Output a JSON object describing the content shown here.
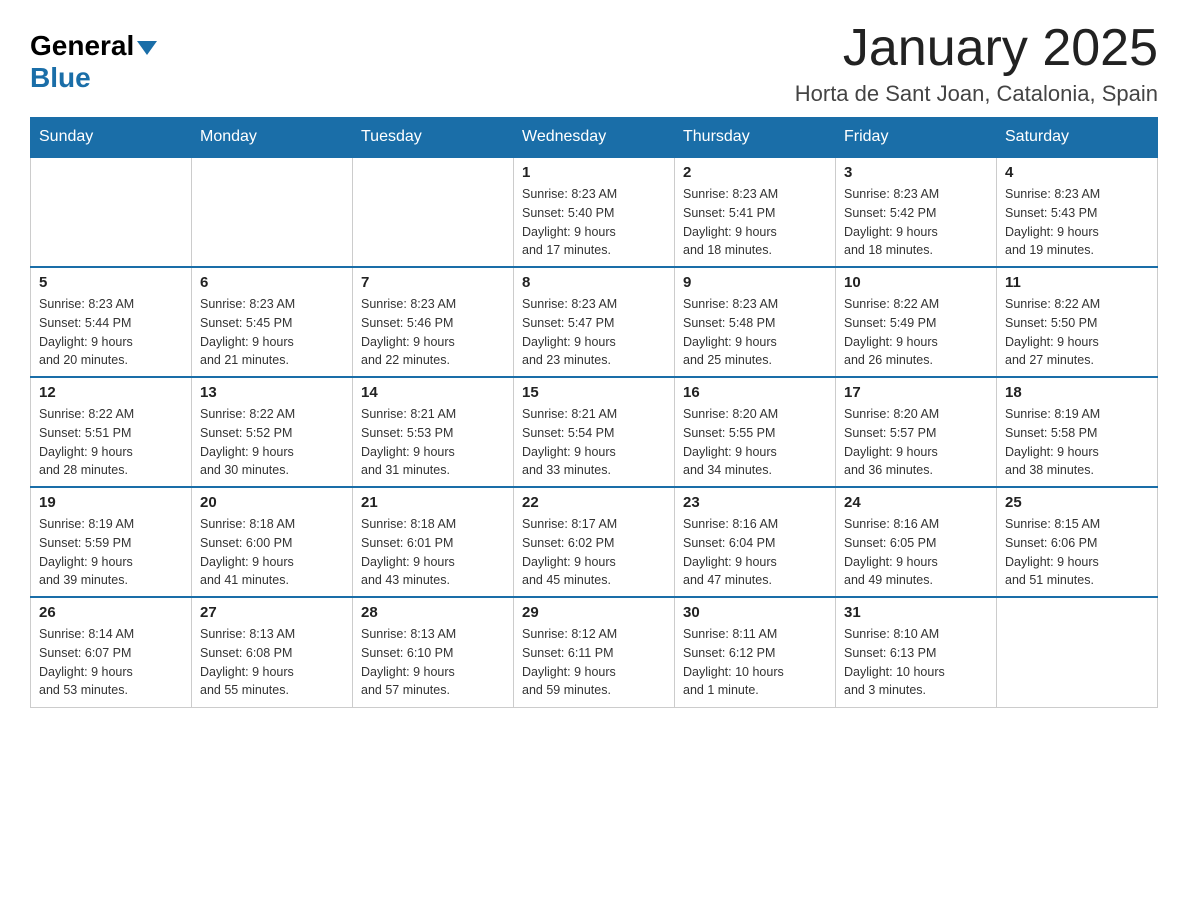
{
  "logo": {
    "general": "General",
    "blue": "Blue"
  },
  "title": "January 2025",
  "location": "Horta de Sant Joan, Catalonia, Spain",
  "weekdays": [
    "Sunday",
    "Monday",
    "Tuesday",
    "Wednesday",
    "Thursday",
    "Friday",
    "Saturday"
  ],
  "weeks": [
    [
      {
        "day": "",
        "info": ""
      },
      {
        "day": "",
        "info": ""
      },
      {
        "day": "",
        "info": ""
      },
      {
        "day": "1",
        "info": "Sunrise: 8:23 AM\nSunset: 5:40 PM\nDaylight: 9 hours\nand 17 minutes."
      },
      {
        "day": "2",
        "info": "Sunrise: 8:23 AM\nSunset: 5:41 PM\nDaylight: 9 hours\nand 18 minutes."
      },
      {
        "day": "3",
        "info": "Sunrise: 8:23 AM\nSunset: 5:42 PM\nDaylight: 9 hours\nand 18 minutes."
      },
      {
        "day": "4",
        "info": "Sunrise: 8:23 AM\nSunset: 5:43 PM\nDaylight: 9 hours\nand 19 minutes."
      }
    ],
    [
      {
        "day": "5",
        "info": "Sunrise: 8:23 AM\nSunset: 5:44 PM\nDaylight: 9 hours\nand 20 minutes."
      },
      {
        "day": "6",
        "info": "Sunrise: 8:23 AM\nSunset: 5:45 PM\nDaylight: 9 hours\nand 21 minutes."
      },
      {
        "day": "7",
        "info": "Sunrise: 8:23 AM\nSunset: 5:46 PM\nDaylight: 9 hours\nand 22 minutes."
      },
      {
        "day": "8",
        "info": "Sunrise: 8:23 AM\nSunset: 5:47 PM\nDaylight: 9 hours\nand 23 minutes."
      },
      {
        "day": "9",
        "info": "Sunrise: 8:23 AM\nSunset: 5:48 PM\nDaylight: 9 hours\nand 25 minutes."
      },
      {
        "day": "10",
        "info": "Sunrise: 8:22 AM\nSunset: 5:49 PM\nDaylight: 9 hours\nand 26 minutes."
      },
      {
        "day": "11",
        "info": "Sunrise: 8:22 AM\nSunset: 5:50 PM\nDaylight: 9 hours\nand 27 minutes."
      }
    ],
    [
      {
        "day": "12",
        "info": "Sunrise: 8:22 AM\nSunset: 5:51 PM\nDaylight: 9 hours\nand 28 minutes."
      },
      {
        "day": "13",
        "info": "Sunrise: 8:22 AM\nSunset: 5:52 PM\nDaylight: 9 hours\nand 30 minutes."
      },
      {
        "day": "14",
        "info": "Sunrise: 8:21 AM\nSunset: 5:53 PM\nDaylight: 9 hours\nand 31 minutes."
      },
      {
        "day": "15",
        "info": "Sunrise: 8:21 AM\nSunset: 5:54 PM\nDaylight: 9 hours\nand 33 minutes."
      },
      {
        "day": "16",
        "info": "Sunrise: 8:20 AM\nSunset: 5:55 PM\nDaylight: 9 hours\nand 34 minutes."
      },
      {
        "day": "17",
        "info": "Sunrise: 8:20 AM\nSunset: 5:57 PM\nDaylight: 9 hours\nand 36 minutes."
      },
      {
        "day": "18",
        "info": "Sunrise: 8:19 AM\nSunset: 5:58 PM\nDaylight: 9 hours\nand 38 minutes."
      }
    ],
    [
      {
        "day": "19",
        "info": "Sunrise: 8:19 AM\nSunset: 5:59 PM\nDaylight: 9 hours\nand 39 minutes."
      },
      {
        "day": "20",
        "info": "Sunrise: 8:18 AM\nSunset: 6:00 PM\nDaylight: 9 hours\nand 41 minutes."
      },
      {
        "day": "21",
        "info": "Sunrise: 8:18 AM\nSunset: 6:01 PM\nDaylight: 9 hours\nand 43 minutes."
      },
      {
        "day": "22",
        "info": "Sunrise: 8:17 AM\nSunset: 6:02 PM\nDaylight: 9 hours\nand 45 minutes."
      },
      {
        "day": "23",
        "info": "Sunrise: 8:16 AM\nSunset: 6:04 PM\nDaylight: 9 hours\nand 47 minutes."
      },
      {
        "day": "24",
        "info": "Sunrise: 8:16 AM\nSunset: 6:05 PM\nDaylight: 9 hours\nand 49 minutes."
      },
      {
        "day": "25",
        "info": "Sunrise: 8:15 AM\nSunset: 6:06 PM\nDaylight: 9 hours\nand 51 minutes."
      }
    ],
    [
      {
        "day": "26",
        "info": "Sunrise: 8:14 AM\nSunset: 6:07 PM\nDaylight: 9 hours\nand 53 minutes."
      },
      {
        "day": "27",
        "info": "Sunrise: 8:13 AM\nSunset: 6:08 PM\nDaylight: 9 hours\nand 55 minutes."
      },
      {
        "day": "28",
        "info": "Sunrise: 8:13 AM\nSunset: 6:10 PM\nDaylight: 9 hours\nand 57 minutes."
      },
      {
        "day": "29",
        "info": "Sunrise: 8:12 AM\nSunset: 6:11 PM\nDaylight: 9 hours\nand 59 minutes."
      },
      {
        "day": "30",
        "info": "Sunrise: 8:11 AM\nSunset: 6:12 PM\nDaylight: 10 hours\nand 1 minute."
      },
      {
        "day": "31",
        "info": "Sunrise: 8:10 AM\nSunset: 6:13 PM\nDaylight: 10 hours\nand 3 minutes."
      },
      {
        "day": "",
        "info": ""
      }
    ]
  ]
}
